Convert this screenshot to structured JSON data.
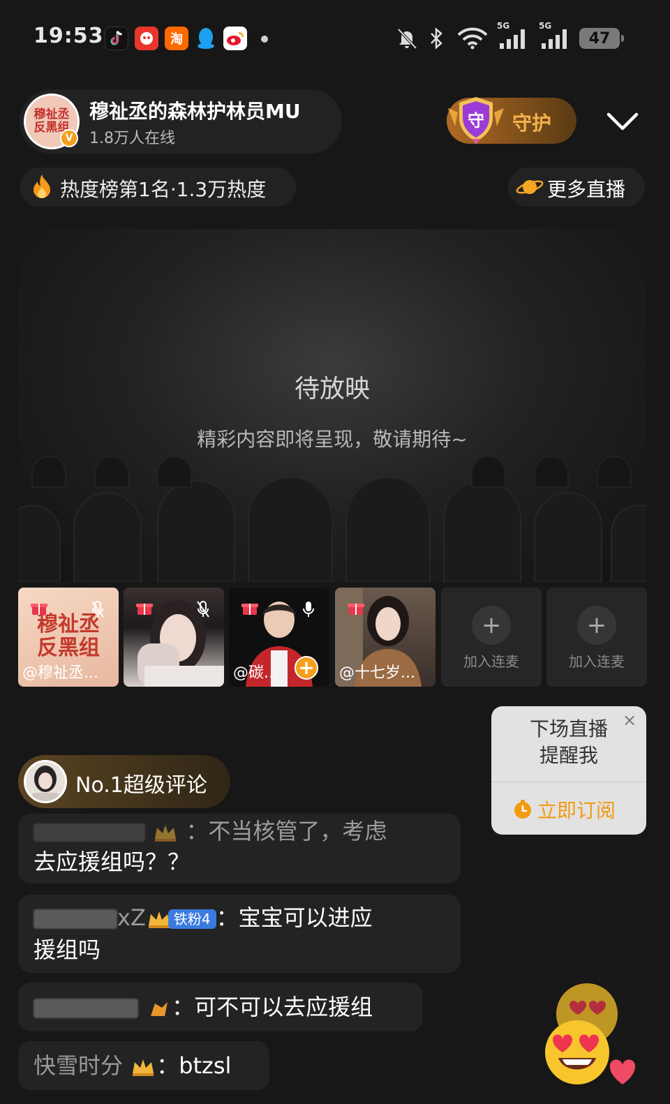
{
  "status_bar": {
    "time": "19:53",
    "apps": [
      "douyin-icon",
      "app-icon",
      "淘",
      "qq-icon",
      "weibo-icon"
    ],
    "network_labels": [
      "5G",
      "5G"
    ],
    "battery": "47"
  },
  "header": {
    "host_name": "穆祉丞的森林护林员MU",
    "online_count": "1.8万人在线",
    "avatar_text": "穆祉丞反黑组",
    "guard_shield_char": "守",
    "guard_label": "守护",
    "hot_rank": "热度榜第1名·1.3万热度",
    "more_live": "更多直播"
  },
  "video": {
    "title": "待放映",
    "subtitle": "精彩内容即将呈现，敬请期待~"
  },
  "cohosts": [
    {
      "name": "@穆祉丞...",
      "banner_text": "穆祉丞反黑组"
    },
    {
      "name": ""
    },
    {
      "name": "@碳..."
    },
    {
      "name": "@十七岁..."
    },
    {
      "join_label": "加入连麦"
    },
    {
      "join_label": "加入连麦"
    }
  ],
  "subscribe": {
    "text_line1": "下场直播",
    "text_line2": "提醒我",
    "action": "立即订阅"
  },
  "super_comment": {
    "label": "No.1超级评论"
  },
  "chat": [
    {
      "partial_text": "：不当核管了，考虑",
      "line2_a": "去应",
      "line2_b": "援组吗？？"
    },
    {
      "name_suffix": "xZ",
      "badge": "铁粉4",
      "text": "：宝宝可以进应",
      "line2": "援组吗"
    },
    {
      "text": "：可不可以去应援组"
    },
    {
      "name": "快雪时分",
      "text": "：btzsl"
    }
  ],
  "colors": {
    "accent_orange": "#f29b12",
    "guard_gold": "#f4b34a",
    "fan_badge_blue": "#3b7be0",
    "background": "#171717"
  }
}
